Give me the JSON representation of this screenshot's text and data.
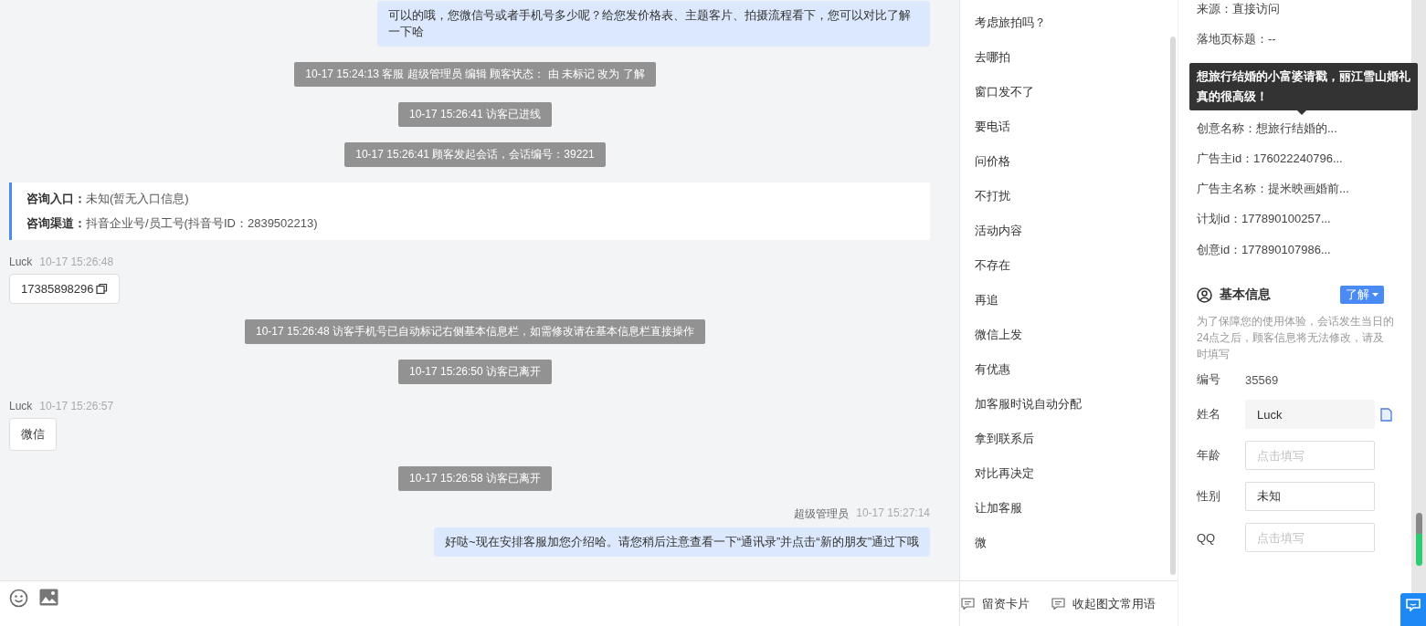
{
  "chat": {
    "messages": [
      {
        "kind": "outgoing",
        "text": "可以的哦，您微信号或者手机号多少呢？给您发价格表、主题客片、拍摄流程看下，您可以对比了解一下哈"
      },
      {
        "kind": "system",
        "text": "10-17 15:24:13 客服 超级管理员 编辑 顾客状态： 由 未标记 改为 了解"
      },
      {
        "kind": "system",
        "text": "10-17 15:26:41 访客已进线"
      },
      {
        "kind": "system",
        "text": "10-17 15:26:41 顾客发起会话，会话编号：39221"
      },
      {
        "kind": "entry",
        "lines": [
          {
            "label": "咨询入口：",
            "value": "未知(暂无入口信息)"
          },
          {
            "label": "咨询渠道：",
            "value": "抖音企业号/员工号(抖音号ID：2839502213)"
          }
        ]
      },
      {
        "kind": "incoming",
        "sender": "Luck",
        "time": "10-17 15:26:48",
        "text": "17385898296",
        "copyable": true
      },
      {
        "kind": "system",
        "text": "10-17 15:26:48 访客手机号已自动标记右侧基本信息栏，如需修改请在基本信息栏直接操作"
      },
      {
        "kind": "system",
        "text": "10-17 15:26:50 访客已离开"
      },
      {
        "kind": "incoming",
        "sender": "Luck",
        "time": "10-17 15:26:57",
        "text": "微信",
        "copyable": false
      },
      {
        "kind": "system",
        "text": "10-17 15:26:58 访客已离开"
      },
      {
        "kind": "outgoing",
        "sender": "超级管理员",
        "time": "10-17 15:27:14",
        "text": "好哒~现在安排客服加您介绍哈。请您稍后注意查看一下“通讯录”并点击“新的朋友”通过下哦"
      }
    ]
  },
  "quick_replies": {
    "items": [
      "考虑旅拍吗？",
      "去哪拍",
      "窗口发不了",
      "要电话",
      "问价格",
      "不打扰",
      "活动内容",
      "不存在",
      "再追",
      "微信上发",
      "有优惠",
      "加客服时说自动分配",
      "拿到联系后",
      "对比再决定",
      "让加客服",
      "微"
    ],
    "footer": [
      "留资卡片",
      "收起图文常用语"
    ]
  },
  "visitor_info": {
    "rows_above": [
      "来源：直接访问",
      "落地页标题：--"
    ],
    "tooltip": "想旅行结婚的小富婆请戳，丽江雪山婚礼真的很高级！",
    "rows_below": [
      "创意名称：想旅行结婚的...",
      "广告主id：176022240796...",
      "广告主名称：提米映画婚前...",
      "计划id：177890100257...",
      "创意id：177890107986..."
    ]
  },
  "basic_info": {
    "title": "基本信息",
    "status": "了解",
    "notice": "为了保障您的使用体验，会话发生当日的24点之后，顾客信息将无法修改，请及时填写",
    "fields": [
      {
        "kind": "text",
        "label": "编号",
        "value": "35569"
      },
      {
        "kind": "readonly",
        "label": "姓名",
        "value": "Luck"
      },
      {
        "kind": "input",
        "label": "年龄",
        "placeholder": "点击填写"
      },
      {
        "kind": "select",
        "label": "性别",
        "value": "未知"
      },
      {
        "kind": "input",
        "label": "QQ",
        "placeholder": "点击填写"
      }
    ]
  }
}
